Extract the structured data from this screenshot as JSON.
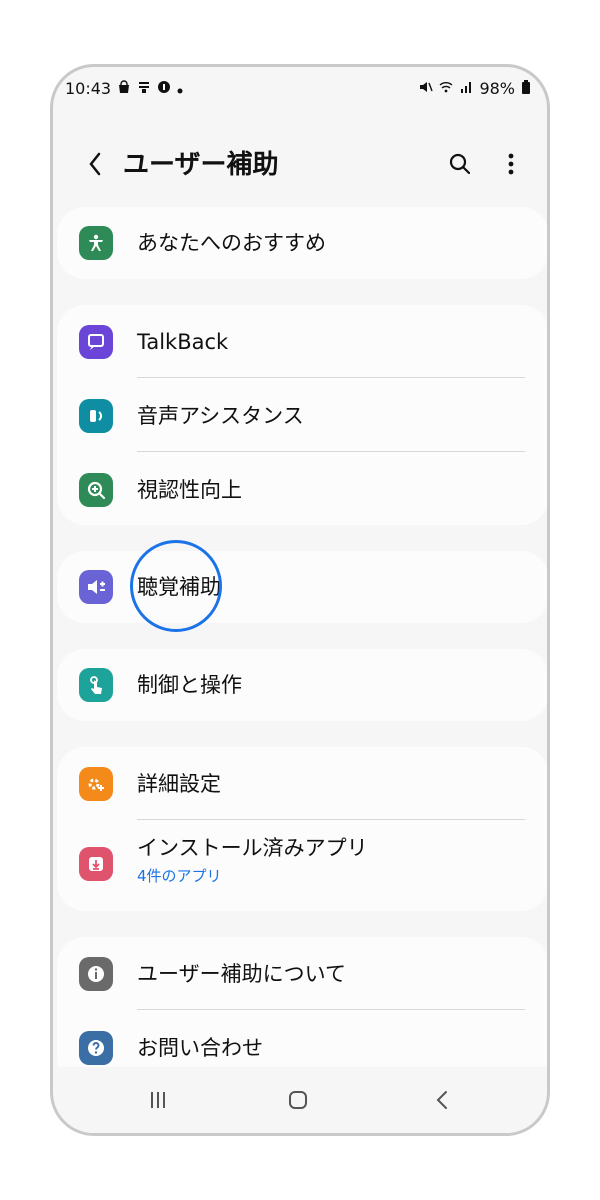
{
  "status_bar": {
    "time": "10:43",
    "battery": "98%"
  },
  "app_bar": {
    "title": "ユーザー補助"
  },
  "sections": [
    {
      "items": [
        {
          "label": "あなたへのおすすめ",
          "icon": "accessibility-person-icon",
          "color": "#2e8b57"
        }
      ]
    },
    {
      "items": [
        {
          "label": "TalkBack",
          "icon": "talkback-icon",
          "color": "#6b45d8"
        },
        {
          "label": "音声アシスタンス",
          "icon": "voice-assistance-icon",
          "color": "#0f8ea3"
        },
        {
          "label": "視認性向上",
          "icon": "visibility-zoom-icon",
          "color": "#2e8b57"
        }
      ]
    },
    {
      "items": [
        {
          "label": "聴覚補助",
          "icon": "hearing-enhancement-icon",
          "color": "#6a63d6"
        }
      ]
    },
    {
      "items": [
        {
          "label": "制御と操作",
          "icon": "interaction-dexterity-icon",
          "color": "#1ea39a"
        }
      ]
    },
    {
      "items": [
        {
          "label": "詳細設定",
          "icon": "advanced-settings-icon",
          "color": "#f48a1a"
        },
        {
          "label": "インストール済みアプリ",
          "sublabel": "4件のアプリ",
          "icon": "installed-apps-icon",
          "color": "#e0536d"
        }
      ]
    },
    {
      "items": [
        {
          "label": "ユーザー補助について",
          "icon": "info-icon",
          "color": "#6a6a6a"
        },
        {
          "label": "お問い合わせ",
          "icon": "help-icon",
          "color": "#3a6ea5"
        }
      ]
    }
  ]
}
